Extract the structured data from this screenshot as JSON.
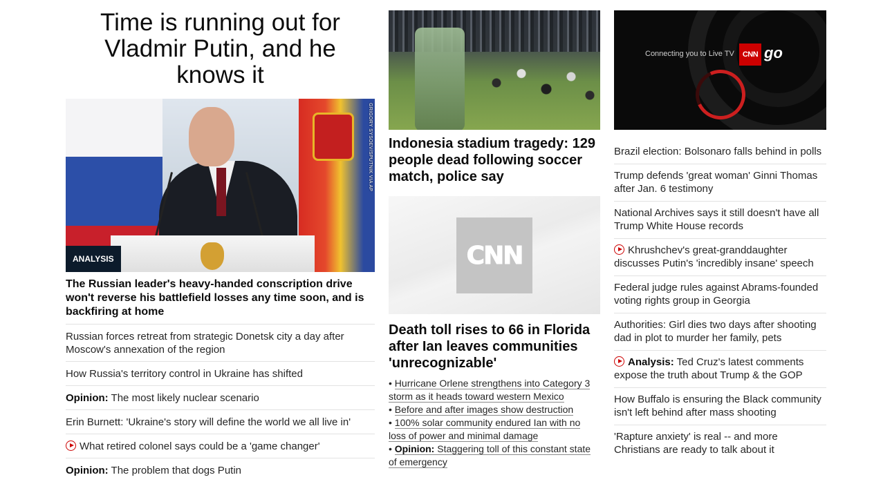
{
  "left": {
    "headline": "Time is running out for Vladmir Putin, and he knows it",
    "photo_credit": "GRIGORY SYSOEV/SPUTNIK VIA AP",
    "badge": "ANALYSIS",
    "summary": "The Russian leader's heavy-handed conscription drive won't reverse his battlefield losses any time soon, and is backfiring at home",
    "links": [
      {
        "lead": "",
        "text": "Russian forces retreat from strategic Donetsk city a day after Moscow's annexation of the region",
        "video": false
      },
      {
        "lead": "",
        "text": "How Russia's territory control in Ukraine has shifted",
        "video": false
      },
      {
        "lead": "Opinion:",
        "text": " The most likely nuclear scenario",
        "video": false
      },
      {
        "lead": "",
        "text": "Erin Burnett: 'Ukraine's story will define the world we all live in'",
        "video": false
      },
      {
        "lead": "",
        "text": "What retired colonel says could be a 'game changer'",
        "video": true
      },
      {
        "lead": "Opinion:",
        "text": " The problem that dogs Putin",
        "video": false
      }
    ]
  },
  "middle": {
    "headline1": "Indonesia stadium tragedy: 129 people dead following soccer match, police say",
    "cnn_logo_text": "CNN",
    "headline2": "Death toll rises to 66 in Florida after Ian leaves communities 'unrecognizable'",
    "bullets": [
      {
        "lead": "",
        "text": "Hurricane Orlene strengthens into Category 3 storm as it heads toward western Mexico"
      },
      {
        "lead": "",
        "text": "Before and after images show destruction"
      },
      {
        "lead": "",
        "text": "100% solar community endured Ian with no loss of power and minimal damage"
      },
      {
        "lead": "Opinion:",
        "text": " Staggering toll of this constant state of emergency"
      }
    ]
  },
  "right": {
    "video": {
      "connecting_text": "Connecting you to Live TV",
      "logo_cnn": "CNN",
      "logo_go": "go"
    },
    "links": [
      {
        "lead": "",
        "text": "Brazil election: Bolsonaro falls behind in polls",
        "video": false
      },
      {
        "lead": "",
        "text": "Trump defends 'great woman' Ginni Thomas after Jan. 6 testimony",
        "video": false
      },
      {
        "lead": "",
        "text": "National Archives says it still doesn't have all Trump White House records",
        "video": false
      },
      {
        "lead": "",
        "text": "Khrushchev's great-granddaughter discusses Putin's 'incredibly insane' speech",
        "video": true
      },
      {
        "lead": "",
        "text": "Federal judge rules against Abrams-founded voting rights group in Georgia",
        "video": false
      },
      {
        "lead": "",
        "text": "Authorities: Girl dies two days after shooting dad in plot to murder her family, pets",
        "video": false
      },
      {
        "lead": "Analysis:",
        "text": " Ted Cruz's latest comments expose the truth about Trump & the GOP",
        "video": true
      },
      {
        "lead": "",
        "text": "How Buffalo is ensuring the Black community isn't left behind after mass shooting",
        "video": false
      },
      {
        "lead": "",
        "text": "'Rapture anxiety' is real -- and more Christians are ready to talk about it",
        "video": false
      }
    ]
  },
  "colors": {
    "accent_red": "#cc0000",
    "badge_bg": "#0c1b2b",
    "text_primary": "#0c0c0c",
    "divider": "#e2e2e2"
  }
}
